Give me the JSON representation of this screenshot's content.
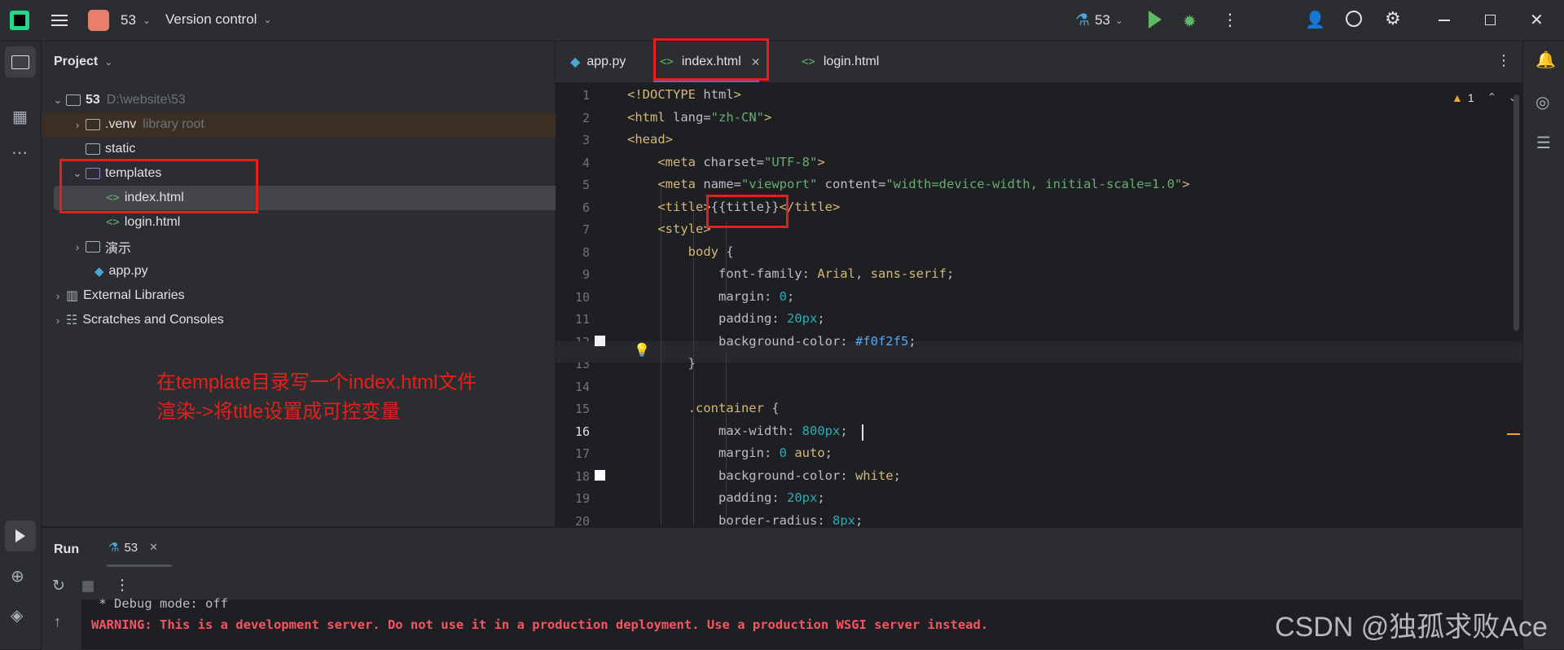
{
  "titlebar": {
    "project_badge": "53",
    "version_control": "Version control",
    "run_config": "53"
  },
  "project": {
    "header": "Project",
    "tree": [
      {
        "label": "53",
        "note": "D:\\website\\53"
      },
      {
        "label": ".venv",
        "note": "library root"
      },
      {
        "label": "static"
      },
      {
        "label": "templates"
      },
      {
        "label": "index.html"
      },
      {
        "label": "login.html"
      },
      {
        "label": "演示"
      },
      {
        "label": "app.py"
      },
      {
        "label": "External Libraries"
      },
      {
        "label": "Scratches and Consoles"
      }
    ]
  },
  "annotation": {
    "line1": "在template目录写一个index.html文件",
    "line2": "渲染->将title设置成可控变量"
  },
  "tabs": [
    "app.py",
    "index.html",
    "login.html"
  ],
  "editor": {
    "warnings": "1",
    "line_numbers": [
      "1",
      "2",
      "3",
      "4",
      "5",
      "6",
      "7",
      "8",
      "9",
      "10",
      "11",
      "12",
      "13",
      "14",
      "15",
      "16",
      "17",
      "18",
      "19",
      "20"
    ],
    "lines": [
      "<!DOCTYPE html>",
      "<html lang=\"zh-CN\">",
      "<head>",
      "    <meta charset=\"UTF-8\">",
      "    <meta name=\"viewport\" content=\"width=device-width, initial-scale=1.0\">",
      "    <title>{{title}}</title>",
      "    <style>",
      "        body {",
      "            font-family: Arial, sans-serif;",
      "            margin: 0;",
      "            padding: 20px;",
      "            background-color: #f0f2f5;",
      "        }",
      "",
      "        .container {",
      "            max-width: 800px;",
      "            margin: 0 auto;",
      "            background-color: white;",
      "            padding: 20px;",
      "            border-radius: 8px;"
    ]
  },
  "run": {
    "title": "Run",
    "tab": "53",
    "console": [
      " * Debug mode: off",
      "WARNING: This is a development server. Do not use it in a production deployment. Use a production WSGI server instead."
    ]
  },
  "watermark": "CSDN @独孤求败Ace",
  "colors": {
    "accent_red": "#e5201c",
    "tab_underline": "#3574f0",
    "warning_text": "#f75464"
  }
}
